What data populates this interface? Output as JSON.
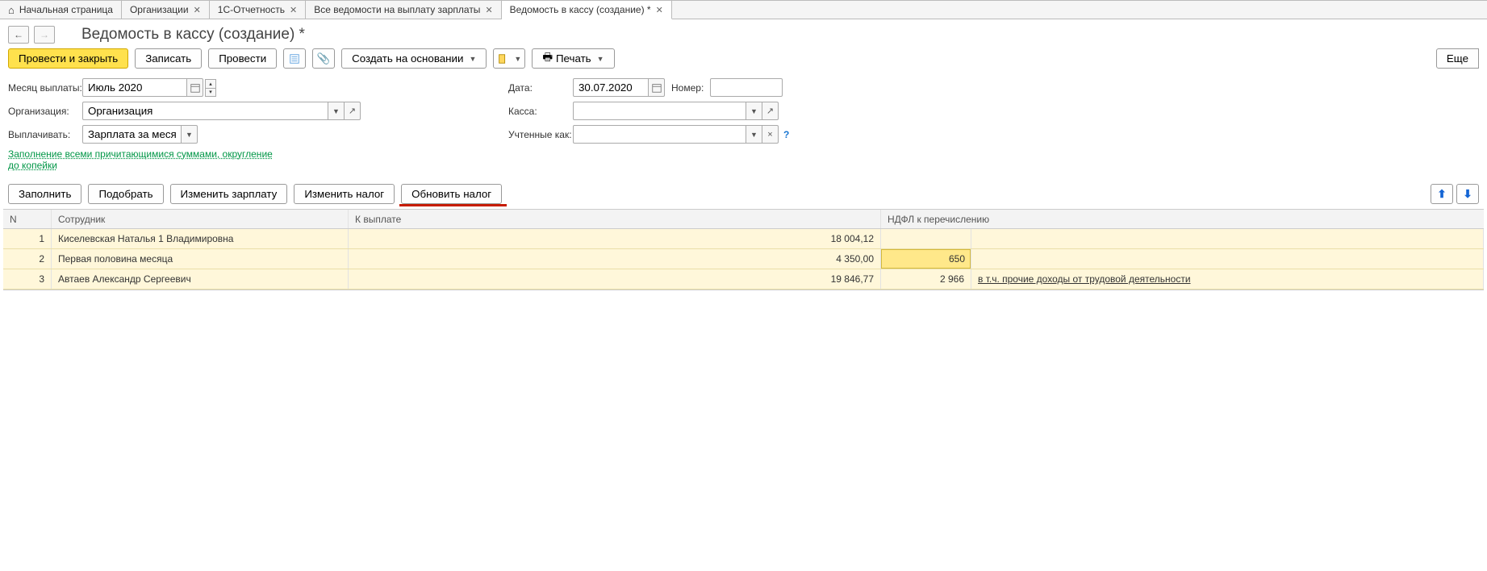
{
  "tabs": [
    {
      "label": "Начальная страница",
      "closable": false,
      "home": true
    },
    {
      "label": "Организации",
      "closable": true
    },
    {
      "label": "1С-Отчетность",
      "closable": true
    },
    {
      "label": "Все ведомости на выплату зарплаты",
      "closable": true
    },
    {
      "label": "Ведомость в кассу (создание) *",
      "closable": true,
      "active": true
    }
  ],
  "page_title": "Ведомость в кассу (создание) *",
  "toolbar": {
    "post_close": "Провести и закрыть",
    "save": "Записать",
    "post": "Провести",
    "create_based": "Создать на основании",
    "print": "Печать",
    "more": "Еще"
  },
  "form": {
    "month_label": "Месяц выплаты:",
    "month_value": "Июль 2020",
    "organization_label": "Организация:",
    "organization_value": "Организация",
    "pay_label": "Выплачивать:",
    "pay_value": "Зарплата за месяц",
    "date_label": "Дата:",
    "date_value": "30.07.2020",
    "number_label": "Номер:",
    "number_value": "",
    "cashbox_label": "Касса:",
    "cashbox_value": "",
    "accounted_label": "Учтенные как:",
    "accounted_value": "",
    "fill_link": "Заполнение всеми причитающимися суммами, округление до копейки"
  },
  "actions": {
    "fill": "Заполнить",
    "pick": "Подобрать",
    "change_salary": "Изменить зарплату",
    "change_tax": "Изменить налог",
    "refresh_tax": "Обновить налог"
  },
  "grid": {
    "headers": {
      "n": "N",
      "employee": "Сотрудник",
      "to_pay": "К выплате",
      "tax": "НДФЛ к перечислению"
    },
    "rows": [
      {
        "n": "1",
        "employee": "Киселевская Наталья 1 Владимировна",
        "to_pay": "18 004,12",
        "tax": "",
        "note": ""
      },
      {
        "n": "2",
        "employee": "Первая половина месяца",
        "to_pay": "4 350,00",
        "tax": "650",
        "highlight_tax": true,
        "note": ""
      },
      {
        "n": "3",
        "employee": "Автаев Александр Сергеевич",
        "to_pay": "19 846,77",
        "tax": "2 966",
        "note": "в т.ч. прочие доходы от трудовой деятельности"
      }
    ]
  }
}
